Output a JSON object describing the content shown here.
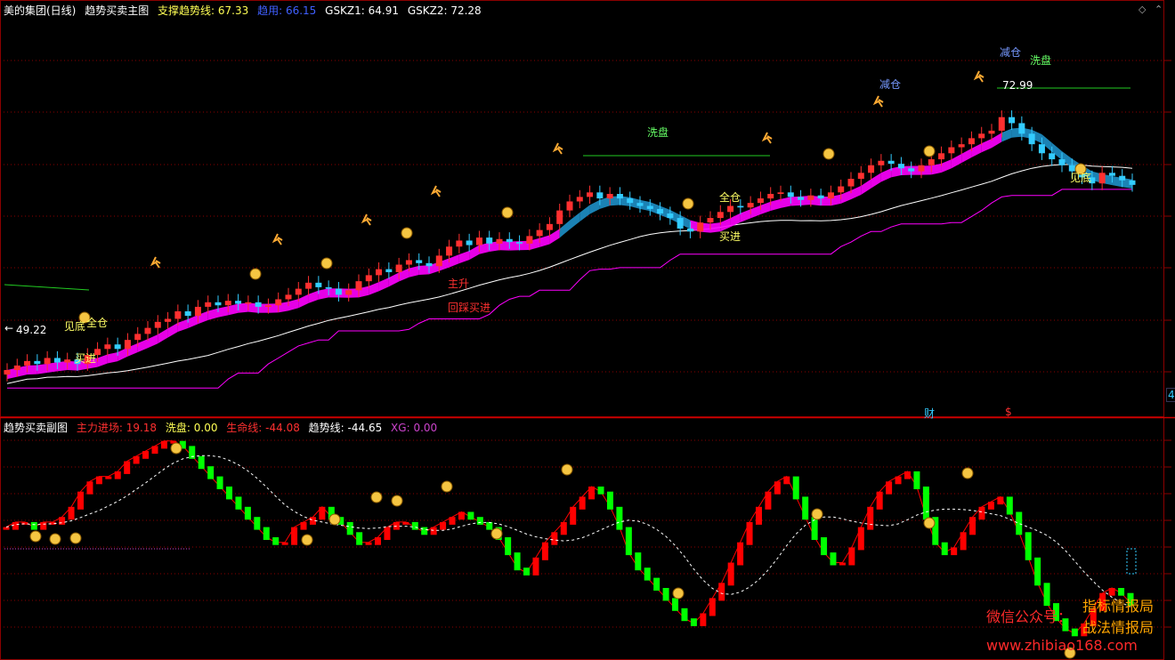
{
  "main_panel": {
    "stock": "美的集团(日线)",
    "indicator": "趋势买卖主图",
    "support_label": "支撑趋势线: ",
    "support_value": "67.33",
    "line2_label": "趋用: ",
    "line2_value": "66.15",
    "gskz1_label": "GSKZ1: ",
    "gskz1_value": "64.91",
    "gskz2_label": "GSKZ2: ",
    "gskz2_value": "72.28",
    "price_high": "72.99",
    "price_low": "49.22",
    "right_tag": "4",
    "marks": {
      "cai": "财",
      "dollar": "$"
    }
  },
  "sub_panel": {
    "indicator": "趋势买卖副图",
    "main_force_label": "主力进场: ",
    "main_force_value": "19.18",
    "wash_label": "洗盘: ",
    "wash_value": "0.00",
    "life_label": "生命线: ",
    "life_value": "-44.08",
    "trend_label": "趋势线: ",
    "trend_value": "-44.65",
    "xg_label": "XG: ",
    "xg_value": "0.00"
  },
  "signals": {
    "jiandi_1": "见底",
    "quancang_1": "全仓",
    "mairu_1": "买进",
    "zhusheng": "主升",
    "huicai": "回踩买进",
    "xipan_1": "洗盘",
    "quancang_2": "全仓",
    "mairu_2": "买进",
    "jiancang_1": "减仓",
    "jiancang_2": "减仓",
    "xipan_2": "洗盘",
    "jiandi_2": "见底"
  },
  "watermark": {
    "line1_a": "微信公众号：",
    "line1_b": "指标情报局",
    "line2": "战法情报局",
    "line3": "www.zhibiao168.com"
  },
  "colors": {
    "up": "#ff3030",
    "down": "#33ccff",
    "ribbon_up": "#ff00ff",
    "ribbon_down": "#1e90c8",
    "support": "#ffffff",
    "step": "#ff00ff",
    "green_bar": "#00ff00",
    "red_bar": "#ff0000",
    "grid": "#8b0000"
  },
  "chart_data": {
    "type": "candlestick",
    "main_candles_close": [
      49.6,
      49.9,
      50.2,
      50.0,
      50.4,
      50.1,
      50.3,
      50.0,
      50.6,
      51.0,
      51.3,
      51.0,
      51.6,
      52.0,
      52.4,
      52.8,
      53.0,
      53.5,
      53.2,
      53.8,
      54.1,
      53.9,
      54.2,
      54.0,
      54.1,
      53.8,
      53.9,
      54.3,
      54.6,
      55.0,
      55.4,
      55.1,
      55.0,
      54.6,
      54.9,
      55.5,
      55.9,
      56.3,
      56.1,
      56.6,
      56.9,
      56.7,
      56.5,
      57.2,
      57.8,
      58.2,
      57.9,
      58.4,
      58.0,
      58.3,
      58.1,
      58.0,
      58.5,
      58.9,
      59.3,
      60.2,
      60.8,
      61.1,
      61.4,
      61.0,
      61.3,
      61.0,
      60.7,
      60.5,
      60.3,
      60.0,
      59.7,
      59.0,
      58.8,
      59.4,
      59.7,
      60.1,
      60.5,
      60.4,
      60.7,
      61.0,
      61.3,
      61.4,
      61.1,
      60.9,
      61.2,
      61.0,
      61.4,
      61.8,
      62.3,
      62.7,
      63.2,
      63.5,
      63.3,
      63.0,
      62.8,
      63.2,
      63.6,
      64.0,
      64.4,
      64.6,
      65.0,
      65.3,
      65.5,
      66.4,
      66.0,
      65.3,
      64.6,
      64.0,
      63.6,
      63.2,
      62.8,
      62.4,
      62.0,
      62.7,
      62.5,
      62.2,
      61.9
    ],
    "main_panel_ylim": [
      47,
      73
    ],
    "support_line_value": 67.33,
    "high_marker": 72.99,
    "low_marker": 49.22,
    "sub_bars": [
      2,
      3,
      3,
      2,
      3,
      3,
      4,
      6,
      9,
      11,
      12,
      12,
      13,
      15,
      16,
      17,
      18,
      19,
      19,
      18,
      16,
      14,
      12,
      10,
      8,
      6,
      4,
      2,
      0,
      -1,
      -1,
      2,
      3,
      4,
      6,
      4,
      3,
      1,
      -1,
      -1,
      0,
      2,
      3,
      3,
      2,
      1,
      2,
      3,
      4,
      5,
      4,
      3,
      2,
      0,
      -3,
      -6,
      -7,
      -4,
      -1,
      1,
      3,
      6,
      8,
      10,
      9,
      6,
      2,
      -3,
      -6,
      -8,
      -10,
      -12,
      -14,
      -16,
      -17,
      -15,
      -12,
      -9,
      -5,
      -1,
      3,
      6,
      9,
      11,
      12,
      8,
      4,
      0,
      -3,
      -5,
      -5,
      -2,
      2,
      6,
      9,
      11,
      12,
      13,
      10,
      4,
      -1,
      -3,
      -2,
      1,
      4,
      6,
      7,
      8,
      5,
      1,
      -4,
      -9,
      -13,
      -16,
      -18,
      -19,
      -17,
      -14,
      -11,
      -10,
      -11,
      -13
    ],
    "sub_panel_ylim": [
      -20,
      20
    ],
    "sub_values": {
      "主力进场": 19.18,
      "洗盘": 0.0,
      "生命线": -44.08,
      "趋势线": -44.65,
      "XG": 0.0
    }
  }
}
